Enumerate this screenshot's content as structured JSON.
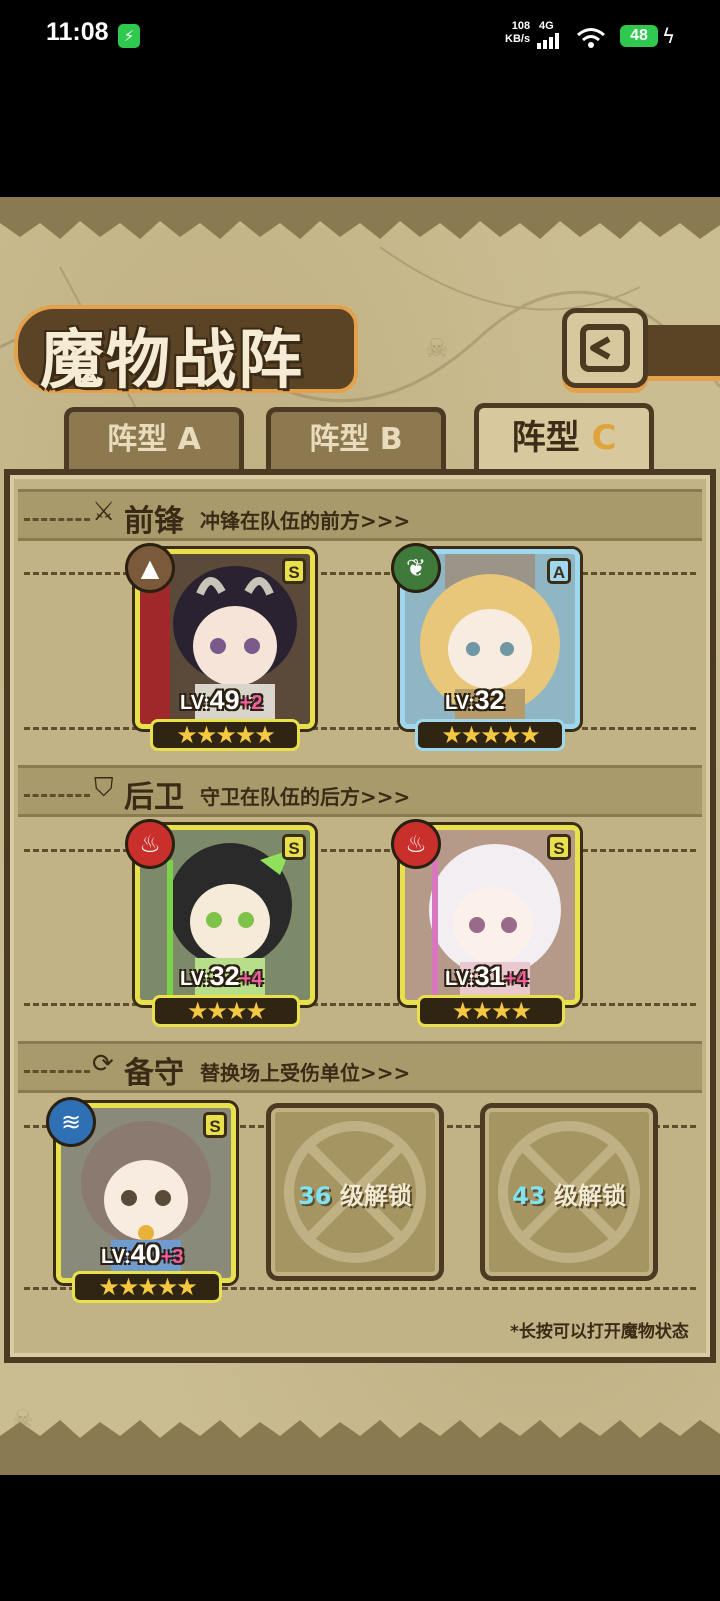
{
  "status_bar": {
    "time": "11:08",
    "net_speed_value": "108",
    "net_speed_unit": "KB/s",
    "network": "4G",
    "battery": "48"
  },
  "screen": {
    "title": "魔物战阵",
    "back_icon": "return-arrow-icon",
    "tabs": [
      {
        "label": "阵型",
        "suffix": "A",
        "active": false
      },
      {
        "label": "阵型",
        "suffix": "B",
        "active": false
      },
      {
        "label": "阵型",
        "suffix": "C",
        "active": true
      }
    ],
    "sections": {
      "front": {
        "title": "前锋",
        "subtitle": "冲锋在队伍的前方>>>",
        "icon": "sword-icon"
      },
      "rear": {
        "title": "后卫",
        "subtitle": "守卫在队伍的后方>>>",
        "icon": "shield-icon"
      },
      "reserve": {
        "title": "备守",
        "subtitle": "替换场上受伤单位>>>",
        "icon": "swap-icon"
      }
    },
    "front_units": [
      {
        "rank": "S",
        "level_prefix": "LV:",
        "level": "49",
        "bonus": "+2",
        "element": "earth",
        "stars": 5,
        "star_text": "★★★★★"
      },
      {
        "rank": "A",
        "level_prefix": "LV:",
        "level": "32",
        "bonus": "",
        "element": "grass",
        "stars": 5,
        "star_text": "★★★★★"
      }
    ],
    "rear_units": [
      {
        "rank": "S",
        "level_prefix": "LV:",
        "level": "32",
        "bonus": "+4",
        "element": "fire",
        "stars": 4,
        "star_text": "★★★★"
      },
      {
        "rank": "S",
        "level_prefix": "LV:",
        "level": "31",
        "bonus": "+4",
        "element": "fire",
        "stars": 4,
        "star_text": "★★★★"
      }
    ],
    "reserve_units": [
      {
        "rank": "S",
        "level_prefix": "LV:",
        "level": "40",
        "bonus": "+3",
        "element": "water",
        "stars": 5,
        "star_text": "★★★★★"
      }
    ],
    "locked_slots": [
      {
        "level": "36",
        "label": "级解锁"
      },
      {
        "level": "43",
        "label": "级解锁"
      }
    ],
    "hint": "*长按可以打开魔物状态"
  },
  "colors": {
    "rank_s": "#e8e14b",
    "rank_a": "#9fd8ee",
    "earth": "#7a5a3a",
    "grass": "#3f7a3a",
    "fire": "#c9302c",
    "water": "#2f6fb3",
    "bonus": "#ef5ea0",
    "unlock_level": "#7fe3f2"
  }
}
